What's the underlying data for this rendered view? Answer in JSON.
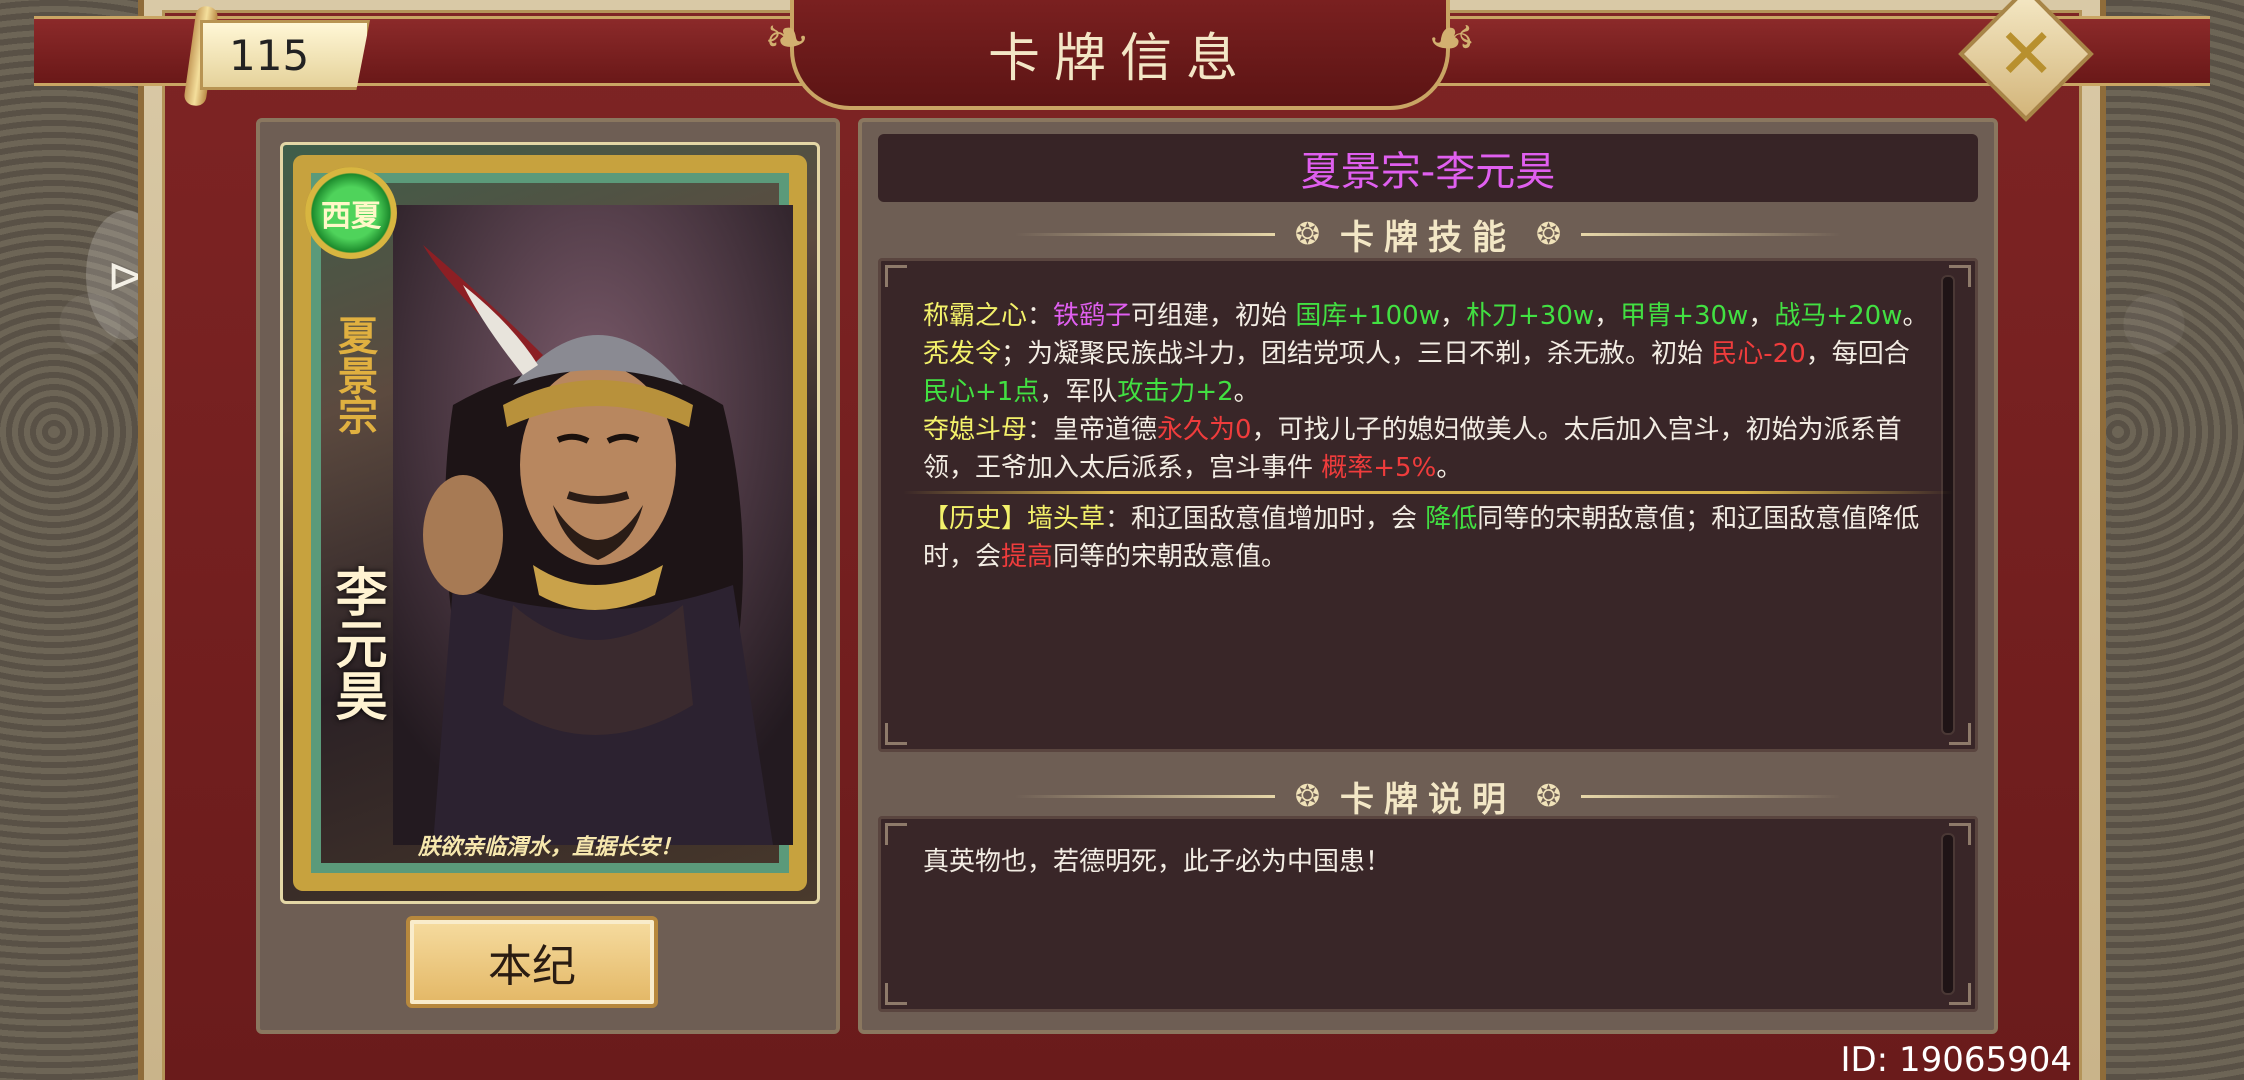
{
  "window": {
    "title": "卡牌信息"
  },
  "level": "115",
  "close_icon": "close-icon",
  "card": {
    "dynasty_emblem": "西夏",
    "dynasty_vertical": "夏景宗",
    "name_vertical": "李元昊",
    "quote": "朕欲亲临渭水，直据长安！",
    "bio_button": "本纪"
  },
  "detail": {
    "name": "夏景宗-李元昊",
    "skills_header": "卡牌技能",
    "description_header": "卡牌说明",
    "description": "真英物也，若德明死，此子必为中国患！",
    "skills": [
      {
        "segments": [
          {
            "t": "称霸之心",
            "c": "y"
          },
          {
            "t": "：",
            "c": "w"
          },
          {
            "t": "铁鹞子",
            "c": "p"
          },
          {
            "t": "可组建，初始 ",
            "c": "w"
          },
          {
            "t": "国库+100w",
            "c": "g"
          },
          {
            "t": "，",
            "c": "w"
          },
          {
            "t": "朴刀+30w",
            "c": "g"
          },
          {
            "t": "，",
            "c": "w"
          },
          {
            "t": "甲胄+30w",
            "c": "g"
          },
          {
            "t": "，",
            "c": "w"
          },
          {
            "t": "战马+20w",
            "c": "g"
          },
          {
            "t": "。",
            "c": "w"
          }
        ]
      },
      {
        "segments": [
          {
            "t": "秃发令",
            "c": "y"
          },
          {
            "t": "；为凝聚民族战斗力，团结党项人，三日不剃，杀无赦。初始 ",
            "c": "w"
          },
          {
            "t": "民心-20",
            "c": "r"
          },
          {
            "t": "，每回合",
            "c": "w"
          },
          {
            "t": "民心+1点",
            "c": "g"
          },
          {
            "t": "，军队",
            "c": "w"
          },
          {
            "t": "攻击力+2",
            "c": "g"
          },
          {
            "t": "。",
            "c": "w"
          }
        ]
      },
      {
        "segments": [
          {
            "t": "夺媳斗母",
            "c": "y"
          },
          {
            "t": "：皇帝道德",
            "c": "w"
          },
          {
            "t": "永久为0",
            "c": "r"
          },
          {
            "t": "，可找儿子的媳妇做美人。太后加入宫斗，初始为派系首领，王爷加入太后派系，宫斗事件 ",
            "c": "w"
          },
          {
            "t": "概率+5%",
            "c": "r"
          },
          {
            "t": "。",
            "c": "w"
          }
        ]
      }
    ],
    "history": {
      "segments": [
        {
          "t": "【历史】墙头草",
          "c": "y"
        },
        {
          "t": "：和辽国敌意值增加时，会 ",
          "c": "w"
        },
        {
          "t": "降低",
          "c": "g"
        },
        {
          "t": "同等的宋朝敌意值；和辽国敌意值降低时，会",
          "c": "w"
        },
        {
          "t": "提高",
          "c": "r"
        },
        {
          "t": "同等的宋朝敌意值。",
          "c": "w"
        }
      ]
    }
  },
  "user_id": "ID: 19065904",
  "side_handle_icon": "drag-handle-icon"
}
